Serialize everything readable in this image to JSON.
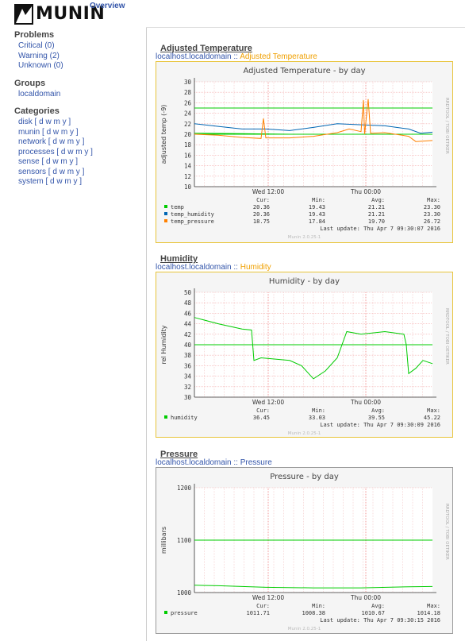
{
  "header": {
    "logo_text": "MUNIN",
    "overview": "Overview"
  },
  "sidebar": {
    "problems_title": "Problems",
    "problems": [
      {
        "label": "Critical (0)"
      },
      {
        "label": "Warning (2)"
      },
      {
        "label": "Unknown (0)"
      }
    ],
    "groups_title": "Groups",
    "groups": [
      {
        "label": "localdomain"
      }
    ],
    "categories_title": "Categories",
    "categories": [
      {
        "label": "disk [ d w m y ]"
      },
      {
        "label": "munin [ d w m y ]"
      },
      {
        "label": "network [ d w m y ]"
      },
      {
        "label": "processes [ d w m y ]"
      },
      {
        "label": "sense [ d w m y ]"
      },
      {
        "label": "sensors [ d w m y ]"
      },
      {
        "label": "system [ d w m y ]"
      }
    ]
  },
  "colors": {
    "temp": "#00cc00",
    "temp_humidity": "#0066b3",
    "temp_pressure": "#ff8000",
    "limit": "#00cc00",
    "grid": "#ff9999"
  },
  "sections": [
    {
      "title": "Adjusted Temperature",
      "crumb_host": "localhost.localdomain",
      "crumb_sep": " :: ",
      "crumb_name": "Adjusted Temperature"
    },
    {
      "title": "Humidity",
      "crumb_host": "localhost.localdomain",
      "crumb_sep": " :: ",
      "crumb_name": "Humidity"
    },
    {
      "title": "Pressure",
      "crumb_host": "localhost.localdomain",
      "crumb_sep": " :: ",
      "crumb_name": "Pressure"
    }
  ],
  "chart_data": [
    {
      "type": "line",
      "title": "Adjusted Temperature - by day",
      "ylabel": "adjusted temp (-9)",
      "ylim": [
        10,
        30
      ],
      "yticks": [
        10,
        12,
        14,
        16,
        18,
        20,
        22,
        24,
        26,
        28,
        30
      ],
      "xlim": [
        0,
        1
      ],
      "xticks": [
        {
          "pos": 0.31,
          "label": "Wed 12:00"
        },
        {
          "pos": 0.72,
          "label": "Thu 00:00"
        }
      ],
      "hlines": [
        25,
        20
      ],
      "series": [
        {
          "name": "temp",
          "color": "#00cc00",
          "points": [
            [
              0,
              20.2
            ],
            [
              0.2,
              20.1
            ],
            [
              0.4,
              20.0
            ],
            [
              0.6,
              20.0
            ],
            [
              0.8,
              20.0
            ],
            [
              1,
              20.0
            ]
          ]
        },
        {
          "name": "temp_humidity",
          "color": "#0066b3",
          "points": [
            [
              0,
              22.0
            ],
            [
              0.1,
              21.5
            ],
            [
              0.2,
              21.0
            ],
            [
              0.3,
              21.0
            ],
            [
              0.4,
              20.7
            ],
            [
              0.5,
              21.3
            ],
            [
              0.6,
              22.0
            ],
            [
              0.7,
              21.8
            ],
            [
              0.8,
              21.6
            ],
            [
              0.9,
              21.0
            ],
            [
              0.95,
              20.2
            ],
            [
              1,
              20.4
            ]
          ]
        },
        {
          "name": "temp_pressure",
          "color": "#ff8000",
          "points": [
            [
              0,
              20.0
            ],
            [
              0.1,
              19.8
            ],
            [
              0.2,
              19.4
            ],
            [
              0.28,
              19.2
            ],
            [
              0.29,
              23.0
            ],
            [
              0.3,
              19.3
            ],
            [
              0.4,
              19.3
            ],
            [
              0.5,
              19.6
            ],
            [
              0.6,
              20.3
            ],
            [
              0.65,
              21.0
            ],
            [
              0.7,
              20.5
            ],
            [
              0.71,
              26.5
            ],
            [
              0.715,
              20.0
            ],
            [
              0.73,
              26.7
            ],
            [
              0.74,
              20.2
            ],
            [
              0.8,
              20.3
            ],
            [
              0.9,
              19.6
            ],
            [
              0.93,
              18.6
            ],
            [
              1,
              18.8
            ]
          ]
        }
      ],
      "legend_headers": [
        "Cur:",
        "Min:",
        "Avg:",
        "Max:"
      ],
      "legend": [
        {
          "name": "temp",
          "color": "#00cc00",
          "cur": "20.36",
          "min": "19.43",
          "avg": "21.21",
          "max": "23.30"
        },
        {
          "name": "temp_humidity",
          "color": "#0066b3",
          "cur": "20.36",
          "min": "19.43",
          "avg": "21.21",
          "max": "23.30"
        },
        {
          "name": "temp_pressure",
          "color": "#ff8000",
          "cur": "18.75",
          "min": "17.84",
          "avg": "19.70",
          "max": "26.72"
        }
      ],
      "last_update": "Last update:  Thu Apr  7 09:30:07 2016",
      "footer": "Munin 2.0.25-1",
      "side_text": "RRDTOOL / TOBI OETIKER"
    },
    {
      "type": "line",
      "title": "Humidity - by day",
      "ylabel": "rel Humidity",
      "ylim": [
        30,
        50
      ],
      "yticks": [
        30,
        32,
        34,
        36,
        38,
        40,
        42,
        44,
        46,
        48,
        50
      ],
      "xlim": [
        0,
        1
      ],
      "xticks": [
        {
          "pos": 0.31,
          "label": "Wed 12:00"
        },
        {
          "pos": 0.72,
          "label": "Thu 00:00"
        }
      ],
      "hlines": [
        40
      ],
      "series": [
        {
          "name": "humidity",
          "color": "#00cc00",
          "points": [
            [
              0,
              45.2
            ],
            [
              0.1,
              44.0
            ],
            [
              0.2,
              43.0
            ],
            [
              0.24,
              42.8
            ],
            [
              0.25,
              37.0
            ],
            [
              0.28,
              37.5
            ],
            [
              0.4,
              37.0
            ],
            [
              0.45,
              36.0
            ],
            [
              0.5,
              33.5
            ],
            [
              0.55,
              35.0
            ],
            [
              0.6,
              37.5
            ],
            [
              0.62,
              40.0
            ],
            [
              0.64,
              42.5
            ],
            [
              0.7,
              42.0
            ],
            [
              0.8,
              42.5
            ],
            [
              0.88,
              42.0
            ],
            [
              0.89,
              40.0
            ],
            [
              0.9,
              34.5
            ],
            [
              0.93,
              35.5
            ],
            [
              0.96,
              37.0
            ],
            [
              1,
              36.4
            ]
          ]
        }
      ],
      "legend_headers": [
        "Cur:",
        "Min:",
        "Avg:",
        "Max:"
      ],
      "legend": [
        {
          "name": "humidity",
          "color": "#00cc00",
          "cur": "36.45",
          "min": "33.03",
          "avg": "39.55",
          "max": "45.22"
        }
      ],
      "last_update": "Last update:  Thu Apr  7 09:30:09 2016",
      "footer": "Munin 2.0.25-1",
      "side_text": "RRDTOOL / TOBI OETIKER"
    },
    {
      "type": "line",
      "title": "Pressure - by day",
      "ylabel": "millibars",
      "ylim": [
        1000,
        1200
      ],
      "yticks": [
        1000,
        1100,
        1200
      ],
      "xlim": [
        0,
        1
      ],
      "xticks": [
        {
          "pos": 0.31,
          "label": "Wed 12:00"
        },
        {
          "pos": 0.72,
          "label": "Thu 00:00"
        }
      ],
      "hlines": [
        1100
      ],
      "series": [
        {
          "name": "pressure",
          "color": "#00cc00",
          "points": [
            [
              0,
              1014
            ],
            [
              0.1,
              1013
            ],
            [
              0.3,
              1010
            ],
            [
              0.5,
              1009
            ],
            [
              0.7,
              1009
            ],
            [
              0.9,
              1011
            ],
            [
              1,
              1011.5
            ]
          ]
        }
      ],
      "legend_headers": [
        "Cur:",
        "Min:",
        "Avg:",
        "Max:"
      ],
      "legend": [
        {
          "name": "pressure",
          "color": "#00cc00",
          "cur": "1011.71",
          "min": "1008.38",
          "avg": "1010.67",
          "max": "1014.18"
        }
      ],
      "last_update": "Last update:  Thu Apr  7 09:30:15 2016",
      "footer": "Munin 2.0.25-1",
      "side_text": "RRDTOOL / TOBI OETIKER"
    }
  ]
}
